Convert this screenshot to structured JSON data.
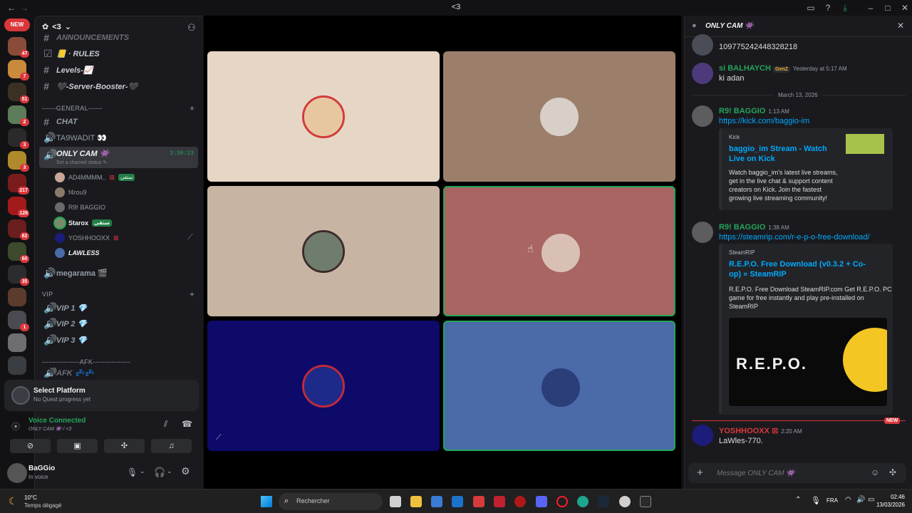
{
  "window": {
    "title": "<3",
    "new_badge": "NEW"
  },
  "server": {
    "name": "<3"
  },
  "rail_badges": [
    "47",
    "7",
    "51",
    "2",
    "3",
    "3",
    "217",
    "126",
    "62",
    "60",
    "35",
    "1"
  ],
  "channels": {
    "top": [
      {
        "name": "ANNOUNCEMENTS"
      },
      {
        "name": "📒 · RULES"
      },
      {
        "name": "Levels-📈"
      },
      {
        "name": "🖤-Server-Booster-🖤"
      }
    ],
    "general_label": "------GENERAL------",
    "general": [
      {
        "name": "CHAT"
      },
      {
        "name": "TA9WADIT 👀"
      },
      {
        "name": "ONLY CAM 👾",
        "timer": "2:39:23",
        "status": "Set a channel status ✎"
      }
    ],
    "voice_users": [
      {
        "name": "AD4MMMM..",
        "tag": "ستقي"
      },
      {
        "name": "f4rou9",
        "tag": ""
      },
      {
        "name": "R9! BAGGIO",
        "tag": ""
      },
      {
        "name": "Starox",
        "tag": "ستقي"
      },
      {
        "name": "YOSHHOOXX",
        "tag": ""
      },
      {
        "name": "LAWLESS",
        "tag": ""
      }
    ],
    "megarama": "megarama 🎬",
    "vip_label": "VIP",
    "vip": [
      {
        "name": "VIP 1 💎"
      },
      {
        "name": "VIP 2 💎"
      },
      {
        "name": "VIP 3 💎"
      }
    ],
    "afk_label": "----------------AFK----------------",
    "afk": "AFK 💤💤"
  },
  "quest": {
    "title": "Select Platform",
    "subtitle": "No Quest progress yet"
  },
  "voice": {
    "status": "Voice Connected",
    "channel": "ONLY CAM 👾 / <3"
  },
  "user": {
    "name": "BaGGio",
    "status": "In voice"
  },
  "tiles": [
    {
      "bg": "#e6d6c6"
    },
    {
      "bg": "#9c7f6b"
    },
    {
      "bg": "#c8b4a3"
    },
    {
      "bg": "#a86562",
      "speaking": true
    },
    {
      "bg": "#0d0a6a"
    },
    {
      "bg": "#4a6aa8",
      "speaking": true
    }
  ],
  "chat": {
    "channel": "ONLY CAM 👾",
    "messages": [
      {
        "author": "",
        "time": "",
        "text": "109775242448328218"
      },
      {
        "author": "si BALHAYCH",
        "badge": "GenZ",
        "time": "Yesterday at 5:17 AM",
        "text": "ki adan"
      },
      {
        "author": "R9! BAGGIO",
        "time": "1:13 AM",
        "link": "https://kick.com/baggio-im",
        "embed": {
          "provider": "Kick",
          "title": "baggio_im Stream - Watch Live on Kick",
          "desc": [
            "Watch baggio_im's latest live streams,",
            "get in the live chat & support content",
            "creators on Kick. Join the fastest",
            "growing live streaming community!"
          ]
        }
      },
      {
        "author": "R9! BAGGIO",
        "time": "1:38 AM",
        "link": "https://steamrip.com/r-e-p-o-free-download/",
        "embed": {
          "provider": "SteamRIP",
          "title": "R.E.P.O. Free Download (v0.3.2 + Co-op) » SteamRIP",
          "desc": [
            "R.E.P.O. Free Download SteamRIP.com Get R.E.P.O. PC",
            "game for free instantly and play pre-installed on",
            "SteamRIP"
          ],
          "image_text": "R.E.P.O."
        }
      },
      {
        "author": "YOSHHOOXX",
        "time": "2:20 AM",
        "text": "LaWles-770."
      }
    ],
    "date_divider": "March 13, 2026",
    "new_label": "NEW",
    "placeholder": "Message ONLY CAM 👾"
  },
  "taskbar": {
    "weather_temp": "10°C",
    "weather_desc": "Temps dégagé",
    "search": "Rechercher",
    "lang": "FRA",
    "time": "02:46",
    "date": "13/03/2026"
  }
}
